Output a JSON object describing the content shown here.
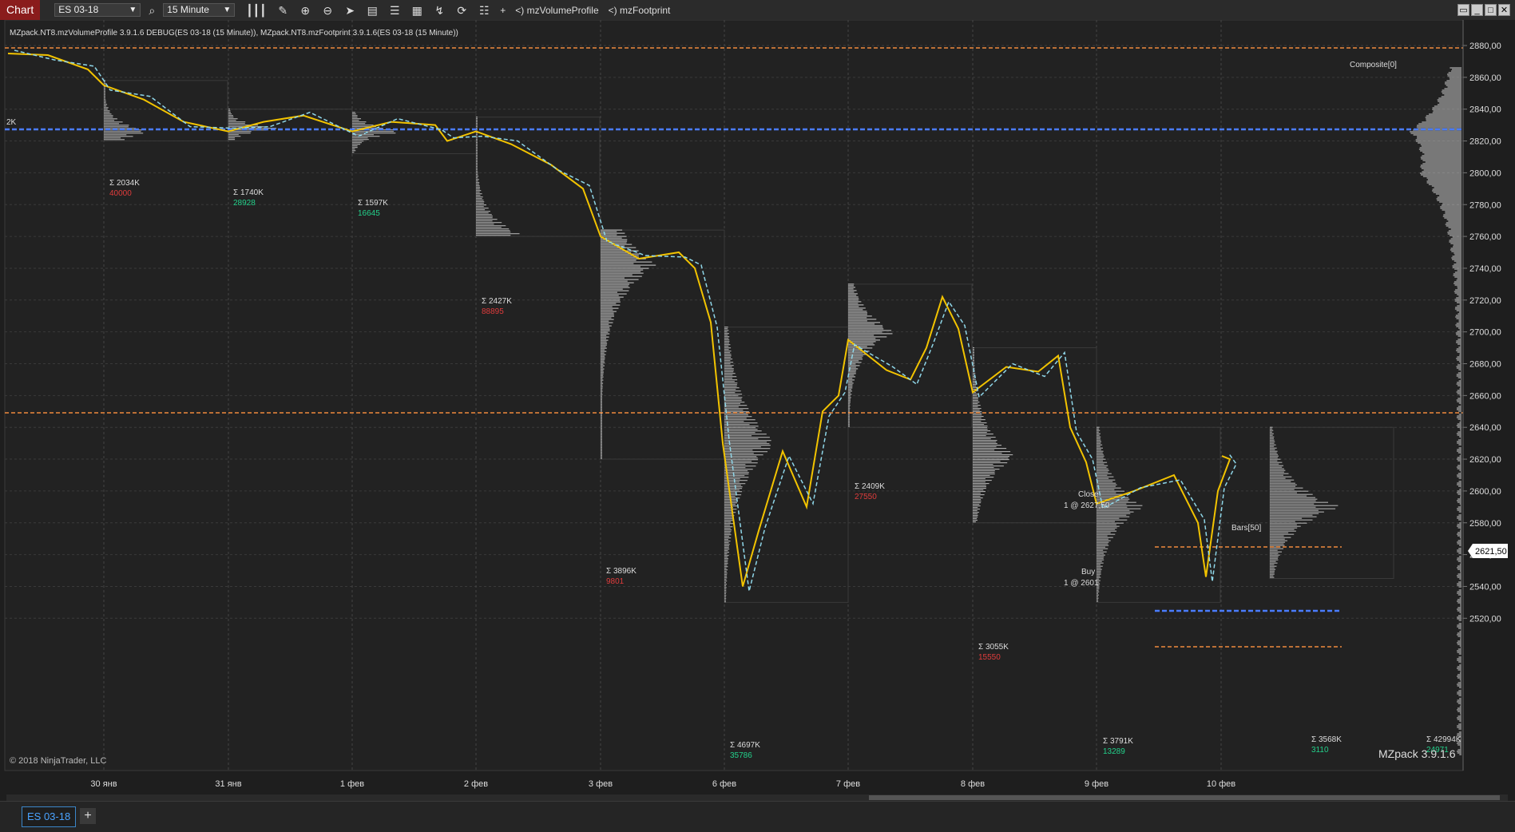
{
  "toolbar": {
    "title": "Chart",
    "instrument": "ES 03-18",
    "interval": "15 Minute",
    "indicator_1": "mzVolumeProfile",
    "indicator_2": "mzFootprint",
    "plus_label": "+",
    "lt1": "<)",
    "lt2": "<)"
  },
  "chart": {
    "header": "MZpack.NT8.mzVolumeProfile 3.9.1.6 DEBUG(ES 03-18 (15 Minute)), MZpack.NT8.mzFootprint 3.9.1.6(ES 03-18 (15 Minute))",
    "copyright": "© 2018 NinjaTrader, LLC",
    "watermark": "MZpack 3.9.1.6",
    "composite_label": "Composite[0]",
    "bars_label": "Bars[50]",
    "left_label": "2K",
    "current_price": "2621,50",
    "close_label": "Close",
    "close_detail": "1 @ 2627,50",
    "buy_label": "Buy",
    "buy_detail": "1 @ 2601",
    "colors": {
      "bg": "#1e1e1e",
      "up": "#23d18b",
      "down": "#e03c3c",
      "orange": "#f08a3c",
      "blue": "#4a7cff",
      "price": "#f2c300"
    },
    "y_axis": [
      "2880,00",
      "2860,00",
      "2840,00",
      "2820,00",
      "2800,00",
      "2780,00",
      "2760,00",
      "2740,00",
      "2720,00",
      "2700,00",
      "2680,00",
      "2660,00",
      "2640,00",
      "2620,00",
      "2600,00",
      "2580,00",
      "2560,00",
      "2540,00",
      "2520,00"
    ],
    "x_axis": [
      "30 янв",
      "31 янв",
      "1 фев",
      "2 фев",
      "3 фев",
      "6 фев",
      "7 фев",
      "8 фев",
      "9 фев",
      "10 фев"
    ],
    "sessions": [
      {
        "total": "Σ 2034K",
        "delta": "40000",
        "delta_sign": "neg"
      },
      {
        "total": "Σ 1740K",
        "delta": "28928",
        "delta_sign": "pos"
      },
      {
        "total": "Σ 1597K",
        "delta": "16645",
        "delta_sign": "pos"
      },
      {
        "total": "Σ 2427K",
        "delta": "88895",
        "delta_sign": "neg"
      },
      {
        "total": "Σ 3896K",
        "delta": "9801",
        "delta_sign": "neg"
      },
      {
        "total": "Σ 4697K",
        "delta": "35786",
        "delta_sign": "pos"
      },
      {
        "total": "Σ 2409K",
        "delta": "27550",
        "delta_sign": "neg"
      },
      {
        "total": "Σ 3055K",
        "delta": "15550",
        "delta_sign": "neg"
      },
      {
        "total": "Σ 3791K",
        "delta": "13289",
        "delta_sign": "pos"
      },
      {
        "total": "Σ 3568K",
        "delta": "3110",
        "delta_sign": "pos"
      },
      {
        "total": "Σ 42994K",
        "delta": "24971",
        "delta_sign": "pos"
      }
    ]
  },
  "bottombar": {
    "tab": "ES 03-18",
    "add": "+"
  }
}
